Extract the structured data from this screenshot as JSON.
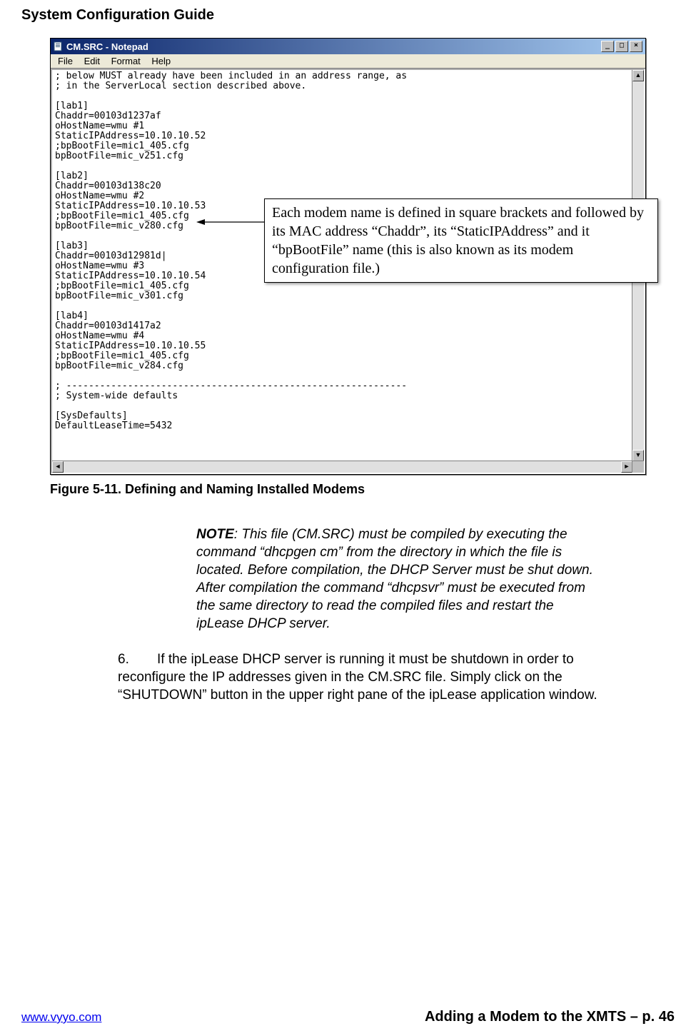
{
  "doc": {
    "header": "System Configuration Guide"
  },
  "window": {
    "title": "CM.SRC - Notepad",
    "menu": {
      "file": "File",
      "edit": "Edit",
      "format": "Format",
      "help": "Help"
    },
    "buttons": {
      "min": "_",
      "max": "□",
      "close": "×"
    },
    "content": "; below MUST already have been included in an address range, as\n; in the ServerLocal section described above.\n\n[lab1]\nChaddr=00103d1237af\noHostName=wmu #1\nStaticIPAddress=10.10.10.52\n;bpBootFile=mic1_405.cfg\nbpBootFile=mic_v251.cfg\n\n[lab2]\nChaddr=00103d138c20\noHostName=wmu #2\nStaticIPAddress=10.10.10.53\n;bpBootFile=mic1_405.cfg\nbpBootFile=mic_v280.cfg\n\n[lab3]\nChaddr=00103d12981d|\noHostName=wmu #3\nStaticIPAddress=10.10.10.54\n;bpBootFile=mic1_405.cfg\nbpBootFile=mic_v301.cfg\n\n[lab4]\nChaddr=00103d1417a2\noHostName=wmu #4\nStaticIPAddress=10.10.10.55\n;bpBootFile=mic1_405.cfg\nbpBootFile=mic_v284.cfg\n\n; -------------------------------------------------------------\n; System-wide defaults\n\n[SysDefaults]\nDefaultLeaseTime=5432"
  },
  "callout": {
    "text": "Each modem name is defined in square brackets and followed by its MAC address “Chaddr”, its “StaticIPAddress” and it “bpBootFile” name (this is also known as its modem configuration file.)"
  },
  "figure": {
    "caption": "Figure 5-11. Defining and Naming Installed Modems"
  },
  "note": {
    "label": "NOTE",
    "text": ": This file (CM.SRC) must be compiled by executing the command “dhcpgen cm” from the directory in which the file is located.  Before compilation, the DHCP Server must be shut down.  After compilation the command “dhcpsvr” must be executed from the same directory to read the compiled files and restart the ipLease DHCP server."
  },
  "step": {
    "num": "6.",
    "text": "If the ipLease DHCP server is running it must be shutdown in order to reconfigure the IP addresses given in the CM.SRC file.  Simply click on the “SHUTDOWN” button in the upper right pane of the ipLease application window."
  },
  "footer": {
    "url": "www.vyyo.com",
    "right": "Adding a Modem to the XMTS – p. 46"
  }
}
